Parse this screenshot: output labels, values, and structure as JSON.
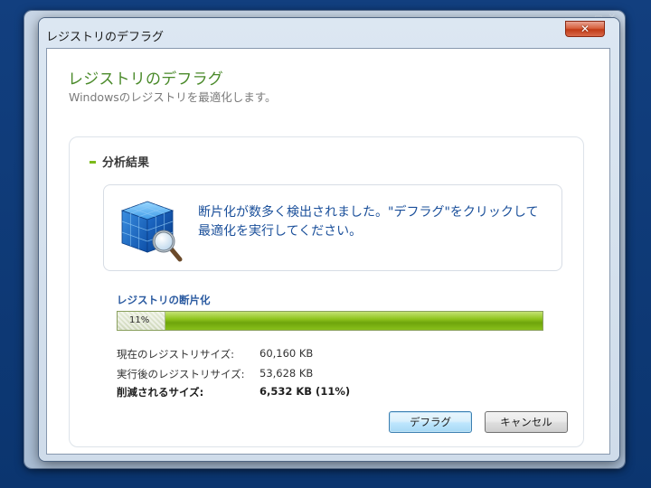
{
  "window": {
    "title": "レジストリのデフラグ",
    "close_glyph": "✕"
  },
  "background_window": {
    "controls": [
      "▭",
      "✕"
    ]
  },
  "header": {
    "title": "レジストリのデフラグ",
    "subtitle": "Windowsのレジストリを最適化します。"
  },
  "section": {
    "title": "分析結果"
  },
  "result": {
    "icon": "registry-cube-magnifier-icon",
    "message": "断片化が数多く検出されました。\"デフラグ\"をクリックして最適化を実行してください。"
  },
  "fragmentation": {
    "label": "レジストリの断片化",
    "percent_text": "11%",
    "percent": 11
  },
  "stats": {
    "current_label": "現在のレジストリサイズ:",
    "current_value": "60,160 KB",
    "after_label": "実行後のレジストリサイズ:",
    "after_value": "53,628 KB",
    "reduced_label": "削減されるサイズ:",
    "reduced_value": "6,532 KB (11%)"
  },
  "buttons": {
    "defrag": "デフラグ",
    "cancel": "キャンセル"
  },
  "colors": {
    "accent_green": "#7cba1b",
    "title_green": "#4a8a2a",
    "message_blue": "#1a4f9a",
    "label_blue": "#2a5aa0"
  }
}
